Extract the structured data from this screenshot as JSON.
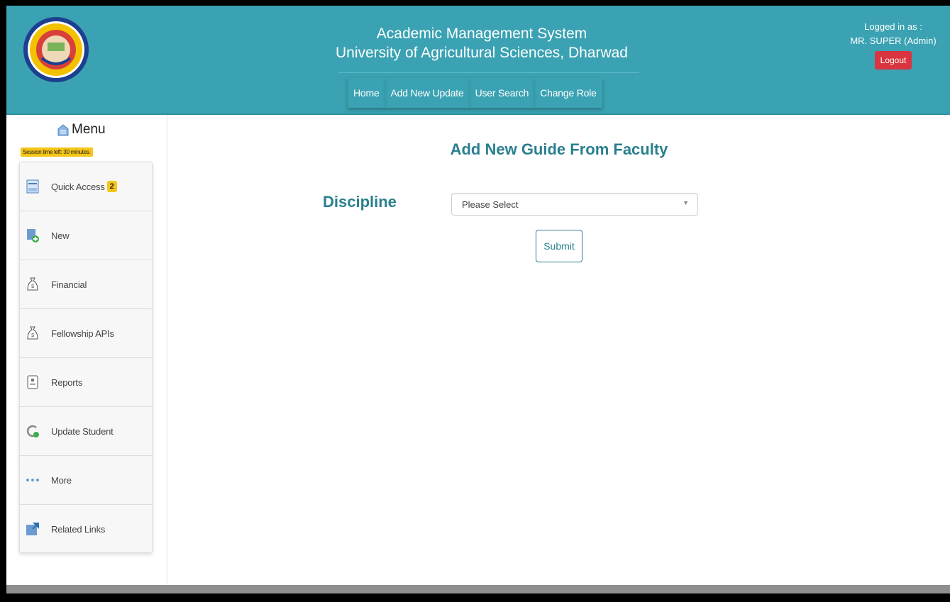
{
  "header": {
    "title_line1": "Academic Management System",
    "title_line2": "University of Agricultural Sciences, Dharwad",
    "nav": [
      "Home",
      "Add New Update",
      "User Search",
      "Change Role"
    ],
    "login_label": "Logged in as :",
    "user": "MR. SUPER (Admin)",
    "logout_label": "Logout"
  },
  "sidebar": {
    "menu_label": "Menu",
    "session_text": "Session time left: 30 minutes.",
    "items": [
      {
        "label": "Quick Access",
        "badge": "2",
        "icon": "inbox-icon"
      },
      {
        "label": "New",
        "icon": "new-document-icon"
      },
      {
        "label": "Financial",
        "icon": "money-bag-icon"
      },
      {
        "label": "Fellowship APIs",
        "icon": "money-bag-icon"
      },
      {
        "label": "Reports",
        "icon": "report-icon"
      },
      {
        "label": "Update Student",
        "icon": "refresh-icon"
      },
      {
        "label": "More",
        "icon": "more-dots-icon"
      },
      {
        "label": "Related Links",
        "icon": "external-link-icon"
      }
    ]
  },
  "main": {
    "page_title": "Add New Guide From Faculty",
    "discipline_label": "Discipline",
    "select_value": "Please Select",
    "submit_label": "Submit"
  },
  "colors": {
    "header_bg": "#3aa2b2",
    "title_teal": "#2a7f8f",
    "logout_red": "#d9343f",
    "badge_yellow": "#f5c518"
  }
}
